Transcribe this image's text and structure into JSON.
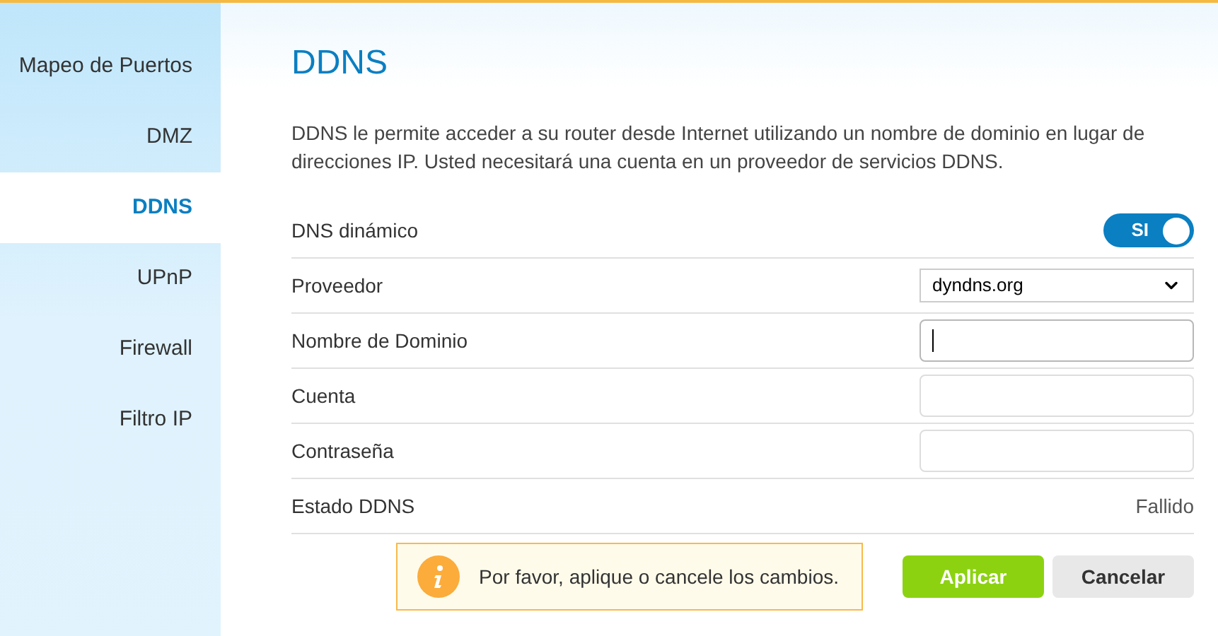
{
  "sidebar": {
    "items": [
      {
        "label": "Mapeo de Puertos",
        "selected": false
      },
      {
        "label": "DMZ",
        "selected": false
      },
      {
        "label": "DDNS",
        "selected": true
      },
      {
        "label": "UPnP",
        "selected": false
      },
      {
        "label": "Firewall",
        "selected": false
      },
      {
        "label": "Filtro IP",
        "selected": false
      }
    ]
  },
  "title": "DDNS",
  "description": "DDNS le permite acceder a su router desde Internet utilizando un nombre de dominio en lugar de direcciones IP. Usted necesitará una cuenta en un proveedor de servicios DDNS.",
  "fields": [
    {
      "kind": "toggle",
      "label": "DNS dinámico",
      "on": true,
      "value": "SI"
    },
    {
      "kind": "select",
      "label": "Proveedor",
      "value": "dyndns.org"
    },
    {
      "kind": "input",
      "label": "Nombre de Dominio",
      "focused": true
    },
    {
      "kind": "input",
      "label": "Cuenta",
      "focused": false
    },
    {
      "kind": "input",
      "label": "Contraseña",
      "focused": false
    },
    {
      "kind": "text",
      "label": "Estado DDNS",
      "value": "Fallido"
    }
  ],
  "notice": "Por favor, aplique o cancele los cambios.",
  "buttons": [
    {
      "kind": "primary",
      "label": "Aplicar"
    },
    {
      "kind": "secondary",
      "label": "Cancelar"
    }
  ]
}
